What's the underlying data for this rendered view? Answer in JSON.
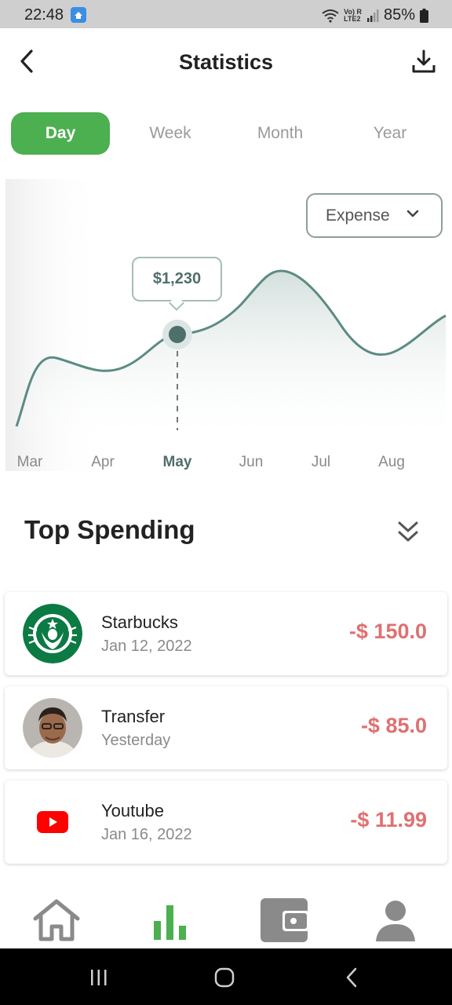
{
  "status_bar": {
    "time": "22:48",
    "battery": "85%",
    "network_top": "Vo) R",
    "network_bottom": "LTE2"
  },
  "header": {
    "title": "Statistics"
  },
  "tabs": [
    {
      "label": "Day",
      "active": true
    },
    {
      "label": "Week",
      "active": false
    },
    {
      "label": "Month",
      "active": false
    },
    {
      "label": "Year",
      "active": false
    }
  ],
  "chart": {
    "dropdown_label": "Expense",
    "tooltip_value": "$1,230",
    "months": [
      "Mar",
      "Apr",
      "May",
      "Jun",
      "Jul",
      "Aug"
    ],
    "selected_month": "May"
  },
  "chart_data": {
    "type": "area",
    "categories": [
      "Mar",
      "Apr",
      "May",
      "Jun",
      "Jul",
      "Aug"
    ],
    "highlight": {
      "category": "May",
      "label": "$1,230"
    },
    "grid": false,
    "legend": "none"
  },
  "top_spending": {
    "title": "Top Spending",
    "items": [
      {
        "name": "Starbucks",
        "date": "Jan 12, 2022",
        "amount": "-$ 150.0",
        "icon": "starbucks-logo"
      },
      {
        "name": "Transfer",
        "date": "Yesterday",
        "amount": "-$ 85.0",
        "icon": "user-avatar"
      },
      {
        "name": "Youtube",
        "date": "Jan 16, 2022",
        "amount": "-$ 11.99",
        "icon": "youtube-logo"
      }
    ]
  },
  "bottom_nav": [
    {
      "name": "home",
      "icon": "home-icon",
      "active": false
    },
    {
      "name": "statistics",
      "icon": "bar-chart-icon",
      "active": true
    },
    {
      "name": "wallet",
      "icon": "wallet-icon",
      "active": false
    },
    {
      "name": "profile",
      "icon": "person-icon",
      "active": false
    }
  ],
  "colors": {
    "accent": "#4caf50",
    "chart_line": "#5c8b84",
    "amount_negative": "#e07070"
  }
}
